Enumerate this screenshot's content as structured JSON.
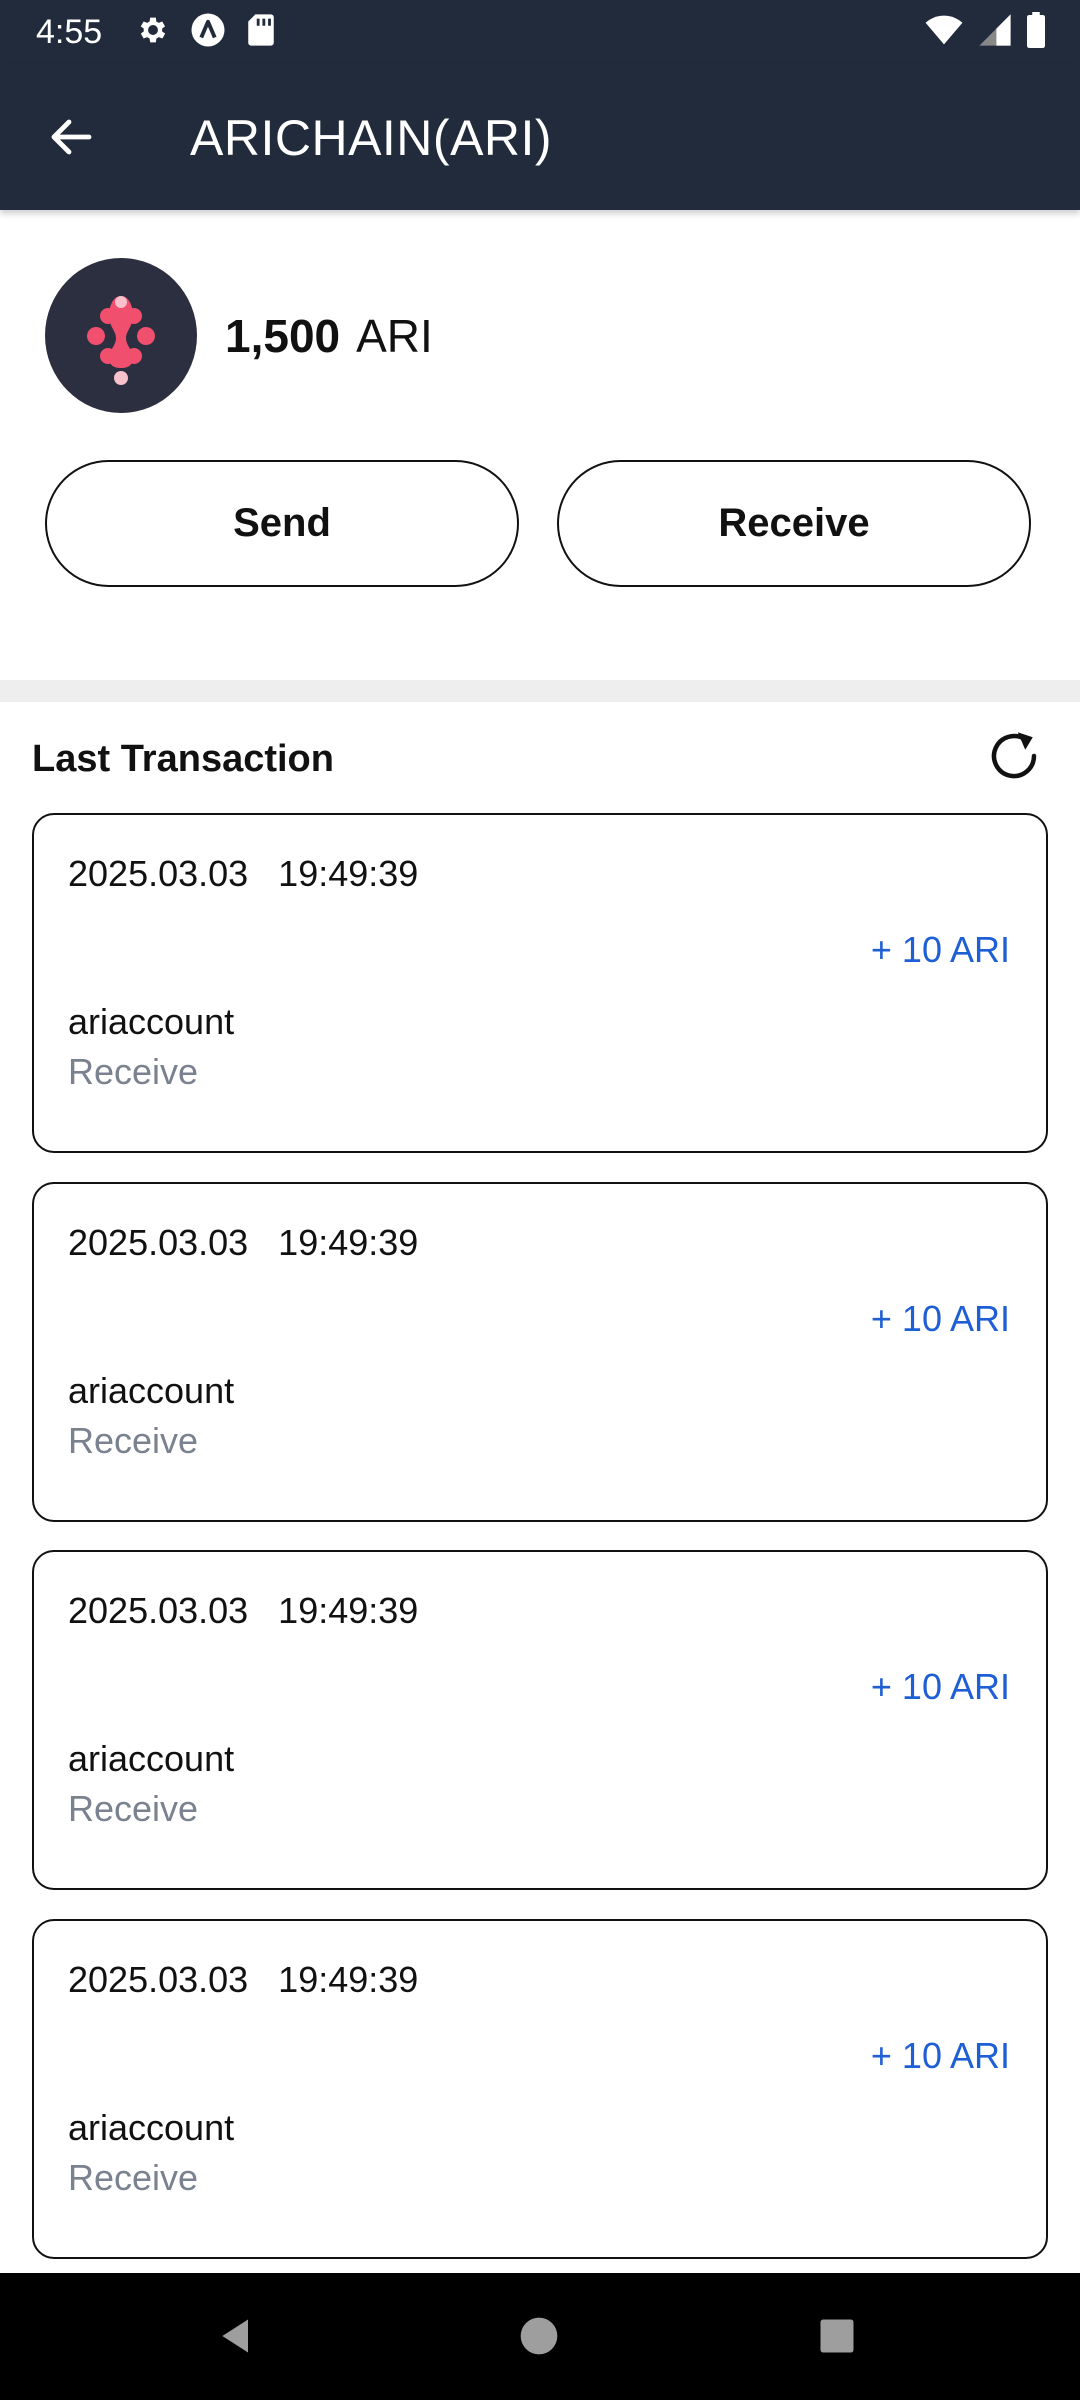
{
  "status_bar": {
    "time": "4:55"
  },
  "app_bar": {
    "title": "ARICHAIN(ARI)",
    "back_icon": "arrow-left-icon"
  },
  "wallet": {
    "logo_icon": "arichain-logo-icon",
    "balance_amount": "1,500",
    "balance_unit": "ARI",
    "send_label": "Send",
    "receive_label": "Receive"
  },
  "transactions_section": {
    "title": "Last Transaction",
    "refresh_icon": "refresh-icon",
    "items": [
      {
        "datetime": "2025.03.03   19:49:39",
        "amount": "+ 10 ARI",
        "account": "ariaccount",
        "type": "Receive"
      },
      {
        "datetime": "2025.03.03   19:49:39",
        "amount": "+ 10 ARI",
        "account": "ariaccount",
        "type": "Receive"
      },
      {
        "datetime": "2025.03.03   19:49:39",
        "amount": "+ 10 ARI",
        "account": "ariaccount",
        "type": "Receive"
      },
      {
        "datetime": "2025.03.03   19:49:39",
        "amount": "+ 10 ARI",
        "account": "ariaccount",
        "type": "Receive"
      }
    ]
  },
  "colors": {
    "header_bg": "#222b3c",
    "amount_blue": "#1f5fd6",
    "muted_text": "#7a8290",
    "logo_pink": "#f0506e"
  }
}
